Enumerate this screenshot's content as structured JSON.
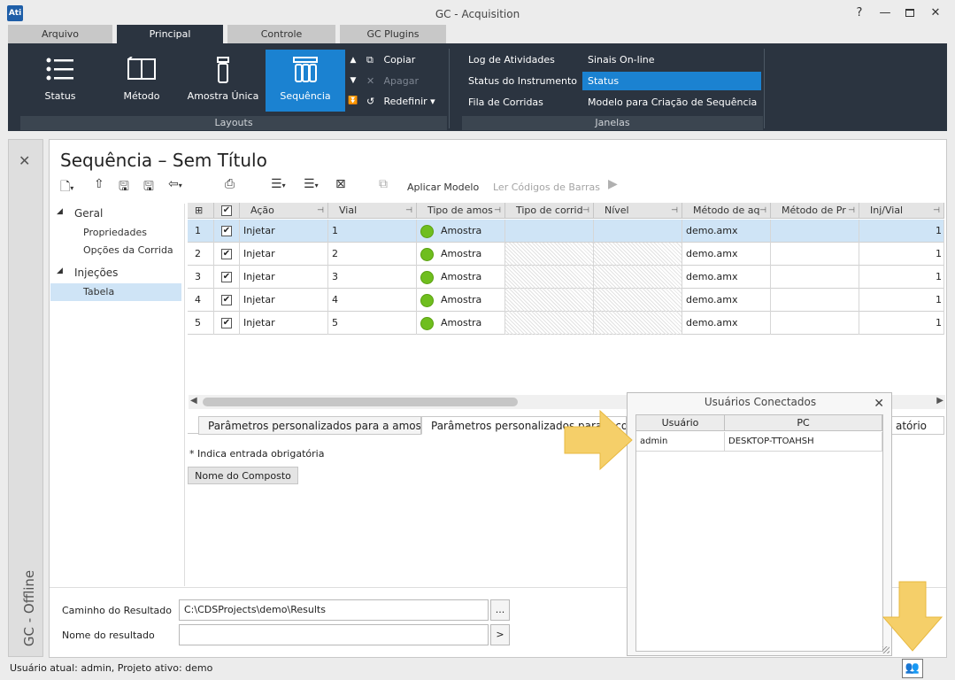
{
  "window": {
    "title": "GC - Acquisition",
    "help": "?",
    "minimize": "🗕",
    "maximize": "🗖",
    "close": "✕",
    "logo": "Ati"
  },
  "tabs": [
    "Arquivo",
    "Principal",
    "Controle",
    "GC Plugins"
  ],
  "ribbon": {
    "layouts": {
      "label": "Layouts",
      "status": "Status",
      "metodo": "Método",
      "amostra": "Amostra Única",
      "sequencia": "Sequência"
    },
    "edit": {
      "copiar": "Copiar",
      "apagar": "Apagar",
      "redefinir": "Redefinir"
    },
    "janelas": {
      "label": "Janelas",
      "log": "Log de Atividades",
      "status_inst": "Status do Instrumento",
      "fila": "Fila de Corridas",
      "sinais": "Sinais On-line",
      "status": "Status",
      "modelo": "Modelo para Criação de Sequência"
    }
  },
  "left_strip": {
    "close": "✕",
    "label": "GC - Offline"
  },
  "document": {
    "title": "Sequência – Sem Título",
    "aplicar": "Aplicar Modelo",
    "ler": "Ler Códigos de Barras"
  },
  "tree": {
    "geral": "Geral",
    "propriedades": "Propriedades",
    "opcoes": "Opções da Corrida",
    "injecoes": "Injeções",
    "tabela": "Tabela"
  },
  "grid": {
    "headers": [
      "Ação",
      "Vial",
      "Tipo de amos",
      "Tipo de corrid",
      "Nível",
      "Método de aq",
      "Método de Pr",
      "Inj/Vial"
    ],
    "rows": [
      {
        "n": "1",
        "acao": "Injetar",
        "vial": "1",
        "tipo": "Amostra",
        "metodo": "demo.amx",
        "inj": "1"
      },
      {
        "n": "2",
        "acao": "Injetar",
        "vial": "2",
        "tipo": "Amostra",
        "metodo": "demo.amx",
        "inj": "1"
      },
      {
        "n": "3",
        "acao": "Injetar",
        "vial": "3",
        "tipo": "Amostra",
        "metodo": "demo.amx",
        "inj": "1"
      },
      {
        "n": "4",
        "acao": "Injetar",
        "vial": "4",
        "tipo": "Amostra",
        "metodo": "demo.amx",
        "inj": "1"
      },
      {
        "n": "5",
        "acao": "Injetar",
        "vial": "5",
        "tipo": "Amostra",
        "metodo": "demo.amx",
        "inj": "1"
      }
    ]
  },
  "bottom_tabs": {
    "tab1": "Parâmetros personalizados para a amostra",
    "tab2": "Parâmetros personalizados para o composto",
    "tab3": "atório"
  },
  "params": {
    "note": "* Indica entrada obrigatória",
    "composto": "Nome do Composto"
  },
  "result": {
    "path_label": "Caminho do Resultado",
    "path_value": "C:\\CDSProjects\\demo\\Results",
    "path_btn": "...",
    "name_label": "Nome do resultado",
    "name_value": "",
    "name_btn": ">"
  },
  "panel": {
    "title": "Usuários Conectados",
    "close": "✕",
    "col_user": "Usuário",
    "col_pc": "PC",
    "user": "admin",
    "pc": "DESKTOP-TTOAHSH"
  },
  "statusbar": {
    "text": "Usuário atual: admin, Projeto ativo: demo"
  },
  "colors": {
    "ribbon": "#2b3440",
    "accent": "#1b82d1",
    "selected_row": "#cfe4f6",
    "arrow": "#f5cf69",
    "status_ok": "#6fbe1e"
  }
}
